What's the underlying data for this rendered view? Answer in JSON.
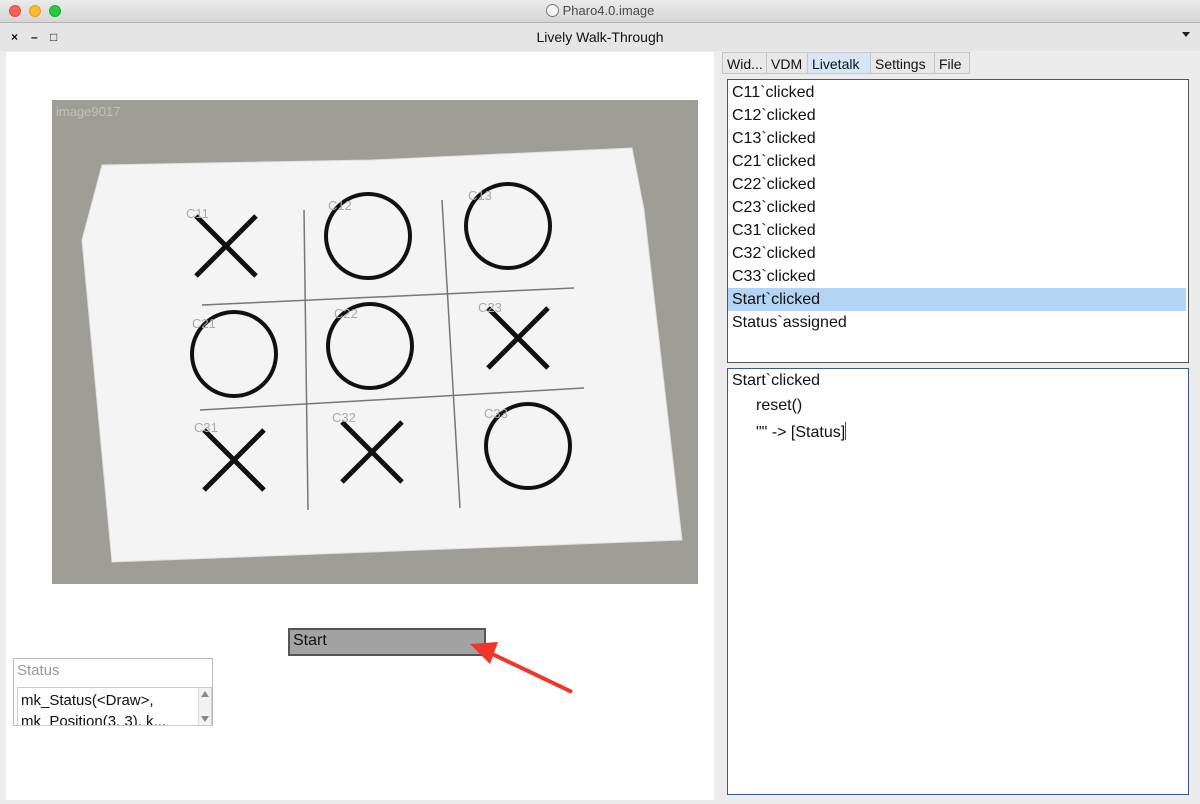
{
  "app_title": "Pharo4.0.image",
  "window": {
    "title": "Lively Walk-Through",
    "close_glyph": "×",
    "minimize_glyph": "–",
    "maximize_glyph": "□"
  },
  "canvas": {
    "photo_label": "image9017",
    "board_cells": [
      "C11",
      "C12",
      "C13",
      "C21",
      "C22",
      "C23",
      "C31",
      "C32",
      "C33"
    ],
    "board_marks": [
      "X",
      "O",
      "O",
      "O",
      "O",
      "X",
      "X",
      "X",
      "O"
    ],
    "start_button_label": "Start",
    "status_label": "Status",
    "status_line1": "mk_Status(<Draw>,",
    "status_line2": "mk_Position(3, 3), k..."
  },
  "tabs": [
    {
      "label": "Wid..."
    },
    {
      "label": "VDM"
    },
    {
      "label": "Livetalk",
      "active": true
    },
    {
      "label": "Settings"
    },
    {
      "label": "File"
    }
  ],
  "events": [
    "C11`clicked",
    "C12`clicked",
    "C13`clicked",
    "C21`clicked",
    "C22`clicked",
    "C23`clicked",
    "C31`clicked",
    "C32`clicked",
    "C33`clicked",
    "Start`clicked",
    "Status`assigned"
  ],
  "selected_event_index": 9,
  "editor": {
    "line1": "Start`clicked",
    "line2": "reset()",
    "line3": "\"\" -> [Status]"
  },
  "colors": {
    "selection": "#b3d4f5",
    "annotation_arrow": "#f0352b"
  }
}
